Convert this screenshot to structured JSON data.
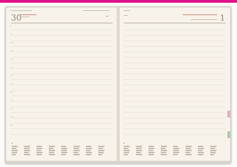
{
  "colors": {
    "accent_band": "#e0128c",
    "tab_pink": "#e8a9b7",
    "tab_green": "#a9cfa9"
  },
  "left_page": {
    "date_number": "30",
    "time_slots": [
      "8",
      "9",
      "10",
      "11",
      "12",
      "13",
      "14",
      "15",
      "16",
      "17",
      "18",
      "19",
      "20"
    ]
  },
  "right_page": {
    "date_number": "1"
  }
}
